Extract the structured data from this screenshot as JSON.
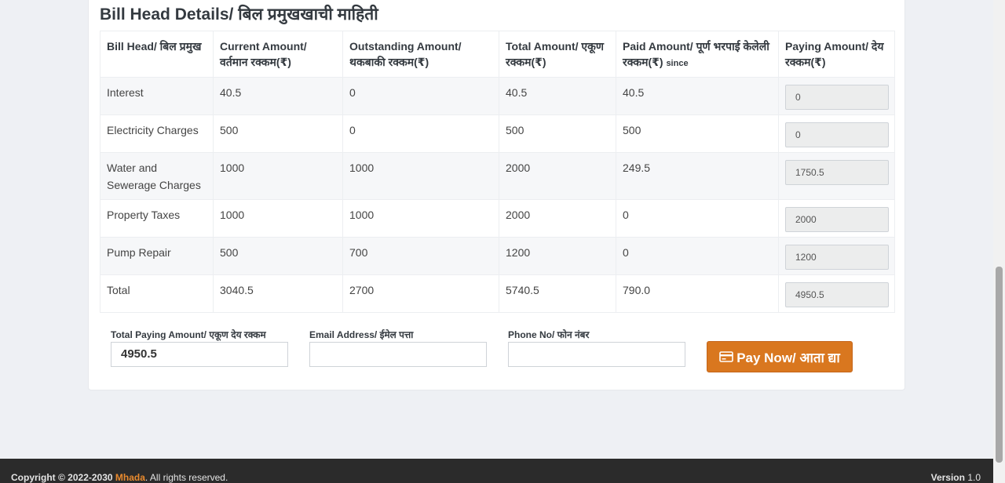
{
  "section": {
    "title": "Bill Head Details/ बिल प्रमुखखाची माहिती"
  },
  "table": {
    "headers": [
      {
        "label": "Bill Head/ बिल प्रमुख",
        "suffix": ""
      },
      {
        "label": "Current Amount/ वर्तमान रक्कम(₹)",
        "suffix": ""
      },
      {
        "label": "Outstanding Amount/ थकबाकी रक्कम(₹)",
        "suffix": ""
      },
      {
        "label": "Total Amount/ एकूण रक्कम(₹)",
        "suffix": ""
      },
      {
        "label": "Paid Amount/ पूर्ण भरपाई केलेली रक्कम(₹)",
        "suffix": "since"
      },
      {
        "label": "Paying Amount/ देय रक्कम(₹)",
        "suffix": ""
      }
    ],
    "rows": [
      {
        "head": "Interest",
        "current": "40.5",
        "outstanding": "0",
        "total": "40.5",
        "paid": "40.5",
        "paying": "0"
      },
      {
        "head": "Electricity Charges",
        "current": "500",
        "outstanding": "0",
        "total": "500",
        "paid": "500",
        "paying": "0"
      },
      {
        "head": "Water and Sewerage Charges",
        "current": "1000",
        "outstanding": "1000",
        "total": "2000",
        "paid": "249.5",
        "paying": "1750.5"
      },
      {
        "head": "Property Taxes",
        "current": "1000",
        "outstanding": "1000",
        "total": "2000",
        "paid": "0",
        "paying": "2000"
      },
      {
        "head": "Pump Repair",
        "current": "500",
        "outstanding": "700",
        "total": "1200",
        "paid": "0",
        "paying": "1200"
      },
      {
        "head": "Total",
        "current": "3040.5",
        "outstanding": "2700",
        "total": "5740.5",
        "paid": "790.0",
        "paying": "4950.5"
      }
    ]
  },
  "form": {
    "total_label": "Total Paying Amount/ एकूण देय रक्कम",
    "total_value": "4950.5",
    "email_label": "Email Address/ ईमेल पत्ता",
    "email_value": "",
    "phone_label": "Phone No/ फोन नंबर",
    "phone_value": "",
    "pay_button_label": "Pay Now/ आता द्या",
    "pay_button_icon": "credit-card-icon"
  },
  "footer": {
    "copyright_prefix": "Copyright © 2022-2030",
    "brand": "Mhada",
    "copyright_suffix": ". All rights reserved.",
    "version_label": "Version",
    "version_value": "1.0"
  },
  "colors": {
    "accent": "#d9771f",
    "brand": "#e88a2e",
    "footer_bg": "#2b2b2b"
  }
}
